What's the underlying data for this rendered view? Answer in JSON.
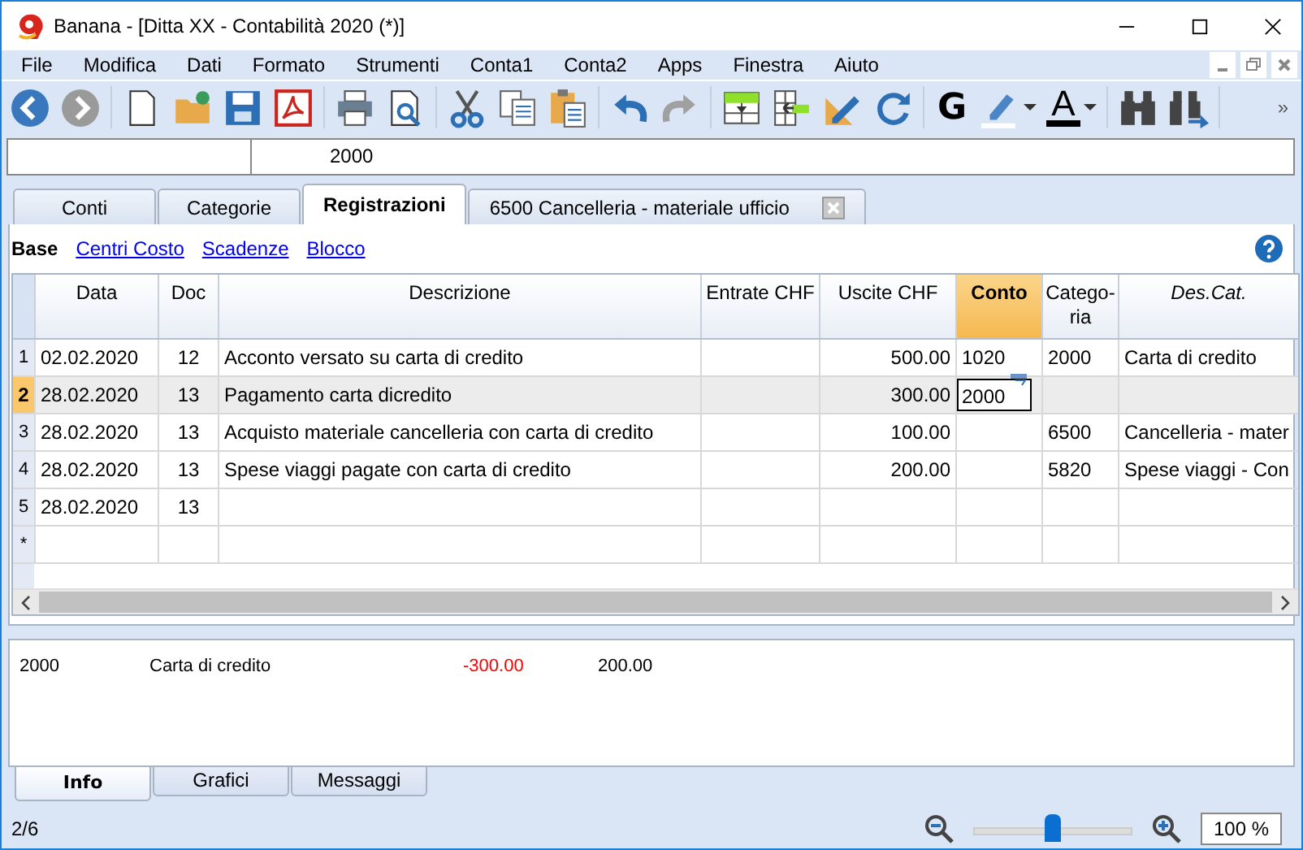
{
  "window": {
    "title": "Banana - [Ditta XX - Contabilità 2020 (*)]"
  },
  "menu": [
    "File",
    "Modifica",
    "Dati",
    "Formato",
    "Strumenti",
    "Conta1",
    "Conta2",
    "Apps",
    "Finestra",
    "Aiuto"
  ],
  "toolbar": {
    "bold_label": "G",
    "font_color_label": "A",
    "overflow": "»"
  },
  "cell_editor": {
    "value": "2000"
  },
  "tabs": [
    {
      "label": "Conti",
      "selected": false,
      "closable": false
    },
    {
      "label": "Categorie",
      "selected": false,
      "closable": false
    },
    {
      "label": "Registrazioni",
      "selected": true,
      "closable": false
    },
    {
      "label": "6500 Cancelleria - materiale ufficio",
      "selected": false,
      "closable": true
    }
  ],
  "views": [
    {
      "label": "Base",
      "selected": true
    },
    {
      "label": "Centri Costo",
      "selected": false
    },
    {
      "label": "Scadenze",
      "selected": false
    },
    {
      "label": "Blocco",
      "selected": false
    }
  ],
  "table": {
    "columns": [
      {
        "label": "Data",
        "selected": false,
        "italic": false
      },
      {
        "label": "Doc",
        "selected": false,
        "italic": false
      },
      {
        "label": "Descrizione",
        "selected": false,
        "italic": false
      },
      {
        "label": "Entrate CHF",
        "selected": false,
        "italic": false
      },
      {
        "label": "Uscite CHF",
        "selected": false,
        "italic": false
      },
      {
        "label": "Conto",
        "selected": true,
        "italic": false
      },
      {
        "label": "Catego-\nria",
        "selected": false,
        "italic": false
      },
      {
        "label": "Des.Cat.",
        "selected": false,
        "italic": true
      }
    ],
    "rows": [
      {
        "number": "1",
        "selected": false,
        "editing": false,
        "cells": [
          "02.02.2020",
          "12",
          "Acconto versato su carta di credito",
          "",
          "500.00",
          "1020",
          "2000",
          "Carta di credito"
        ]
      },
      {
        "number": "2",
        "selected": true,
        "editing": true,
        "cells": [
          "28.02.2020",
          "13",
          "Pagamento carta dicredito",
          "",
          "300.00",
          "2000",
          "",
          ""
        ]
      },
      {
        "number": "3",
        "selected": false,
        "editing": false,
        "cells": [
          "28.02.2020",
          "13",
          "Acquisto materiale cancelleria con carta di credito",
          "",
          "100.00",
          "",
          "6500",
          "Cancelleria - mater"
        ]
      },
      {
        "number": "4",
        "selected": false,
        "editing": false,
        "cells": [
          "28.02.2020",
          "13",
          "Spese viaggi pagate con carta di credito",
          "",
          "200.00",
          "",
          "5820",
          "Spese viaggi - Con"
        ]
      },
      {
        "number": "5",
        "selected": false,
        "editing": false,
        "cells": [
          "28.02.2020",
          "13",
          "",
          "",
          "",
          "",
          "",
          ""
        ]
      },
      {
        "number": "*",
        "selected": false,
        "editing": false,
        "cells": [
          "",
          "",
          "",
          "",
          "",
          "",
          "",
          ""
        ]
      }
    ]
  },
  "info": [
    {
      "text": "2000",
      "negative": false
    },
    {
      "text": "Carta di credito",
      "negative": false
    },
    {
      "text": "-300.00",
      "negative": true
    },
    {
      "text": "200.00",
      "negative": false
    }
  ],
  "bottom_tabs": [
    {
      "label": "Info",
      "selected": true
    },
    {
      "label": "Grafici",
      "selected": false
    },
    {
      "label": "Messaggi",
      "selected": false
    }
  ],
  "status": {
    "position": "2/6",
    "zoom": {
      "level": 0.5,
      "value": "100 %"
    }
  }
}
